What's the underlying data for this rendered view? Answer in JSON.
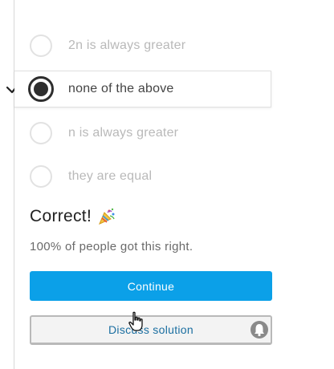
{
  "options": [
    {
      "label": "2n is always greater",
      "selected": false
    },
    {
      "label": "none of the above",
      "selected": true
    },
    {
      "label": "n is always greater",
      "selected": false
    },
    {
      "label": "they are equal",
      "selected": false
    }
  ],
  "result": {
    "title": "Correct!",
    "stat": "100% of people got this right."
  },
  "buttons": {
    "continue_label": "Continue",
    "discuss_label": "Discuss solution"
  },
  "colors": {
    "accent": "#0ba0e8",
    "selected": "#2e2e2e",
    "muted_text": "#b9b9b9"
  },
  "icons": {
    "check": "checkmark-icon",
    "party": "party-popper-icon",
    "bell": "bell-icon",
    "cursor": "hand-pointer-cursor"
  }
}
